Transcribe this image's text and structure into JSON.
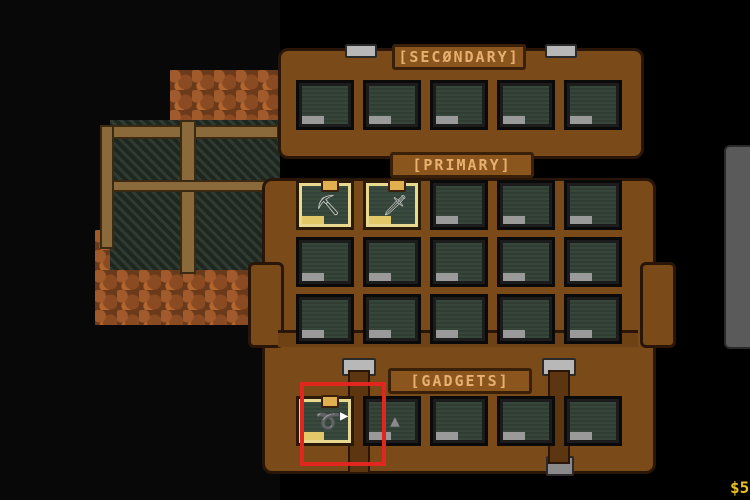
{
  "inventory": {
    "secondary_label": "[SECØNDARY]",
    "primary_label": "[PRIMARY]",
    "gadgets_label": "[GADGETS]",
    "secondary_slots": [
      {
        "filled": false
      },
      {
        "filled": false
      },
      {
        "filled": false
      },
      {
        "filled": false
      },
      {
        "filled": false
      }
    ],
    "primary_slots": [
      {
        "filled": true,
        "icon": "pickaxe-icon"
      },
      {
        "filled": true,
        "icon": "sword-icon"
      },
      {
        "filled": false
      },
      {
        "filled": false
      },
      {
        "filled": false
      },
      {
        "filled": false
      },
      {
        "filled": false
      },
      {
        "filled": false
      },
      {
        "filled": false
      },
      {
        "filled": false
      },
      {
        "filled": false
      },
      {
        "filled": false
      },
      {
        "filled": false
      },
      {
        "filled": false
      },
      {
        "filled": false
      }
    ],
    "gadget_slots": [
      {
        "filled": true,
        "icon": "rope-icon",
        "selected": true
      },
      {
        "filled": false,
        "icon": "bomb-icon"
      },
      {
        "filled": false
      },
      {
        "filled": false
      },
      {
        "filled": false
      }
    ]
  },
  "hud": {
    "money": "$5"
  },
  "colors": {
    "highlight": "#e0261e",
    "pack": "#7a4a18",
    "money": "#e8c020"
  }
}
